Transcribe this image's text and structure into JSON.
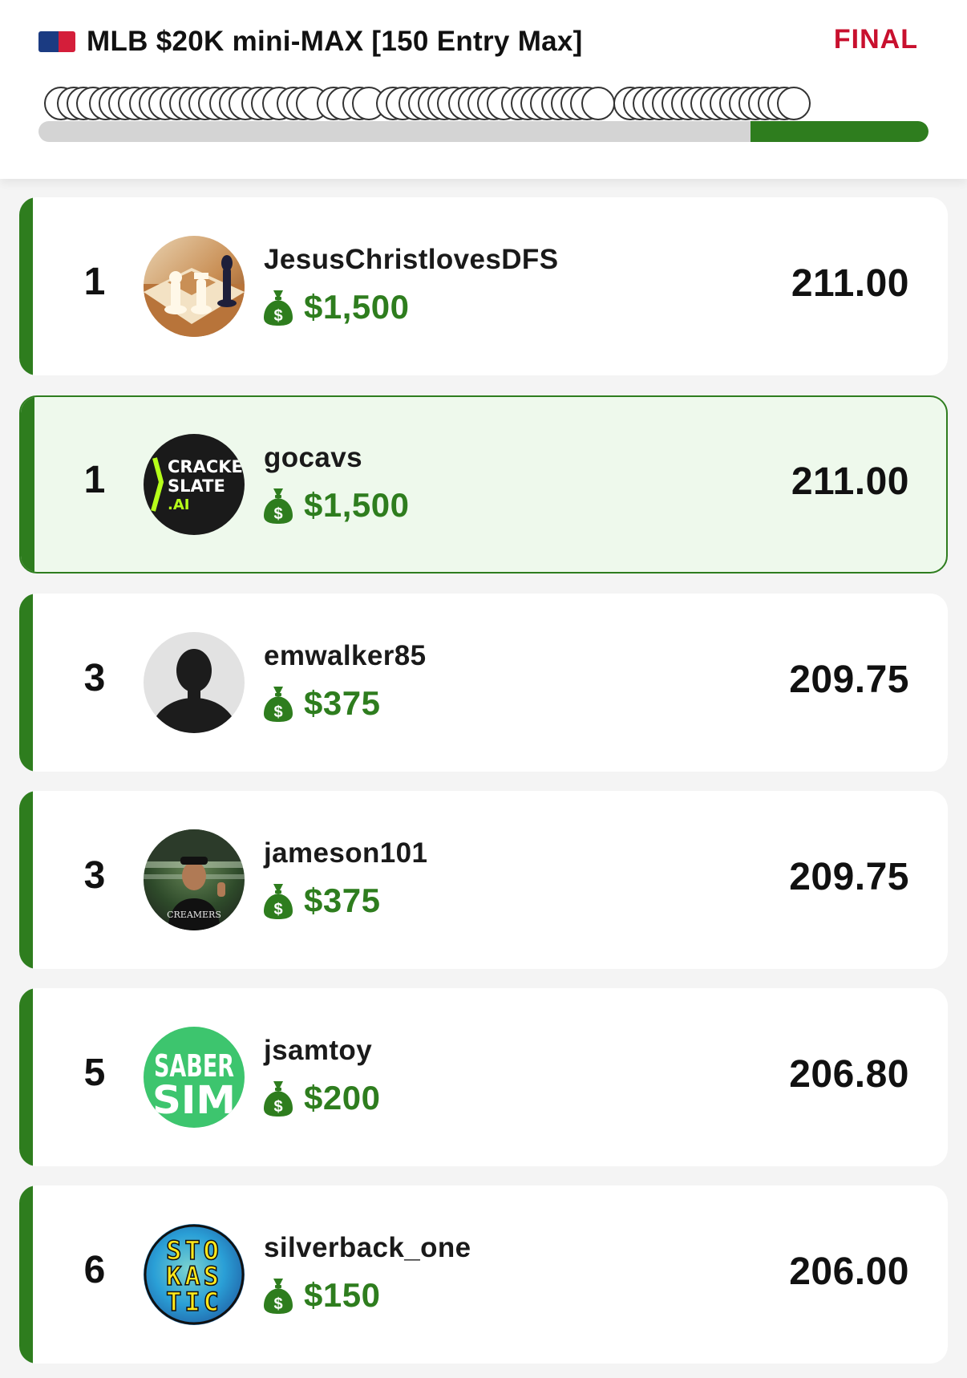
{
  "header": {
    "title": "MLB $20K mini-MAX [150 Entry Max]",
    "status": "FINAL",
    "progress_percent": 20,
    "colors": {
      "status": "#c8102e",
      "accent": "#2e7d1e"
    }
  },
  "entries": [
    {
      "rank": "1",
      "username": "JesusChristlovesDFS",
      "prize": "$1,500",
      "score": "211.00",
      "avatar": "chess-avatar",
      "highlighted": false
    },
    {
      "rank": "1",
      "username": "gocavs",
      "prize": "$1,500",
      "score": "211.00",
      "avatar": "cracked-slate-avatar",
      "avatar_text": [
        "CRACKED",
        "SLATE",
        ".AI"
      ],
      "highlighted": true
    },
    {
      "rank": "3",
      "username": "emwalker85",
      "prize": "$375",
      "score": "209.75",
      "avatar": "default-user-avatar",
      "highlighted": false
    },
    {
      "rank": "3",
      "username": "jameson101",
      "prize": "$375",
      "score": "209.75",
      "avatar": "photo-avatar",
      "highlighted": false
    },
    {
      "rank": "5",
      "username": "jsamtoy",
      "prize": "$200",
      "score": "206.80",
      "avatar": "sabersim-avatar",
      "avatar_text": [
        "SABER",
        "SIM"
      ],
      "highlighted": false
    },
    {
      "rank": "6",
      "username": "silverback_one",
      "prize": "$150",
      "score": "206.00",
      "avatar": "stokastic-avatar",
      "avatar_text": [
        "STO",
        "KAS",
        "TIC"
      ],
      "highlighted": false
    }
  ]
}
